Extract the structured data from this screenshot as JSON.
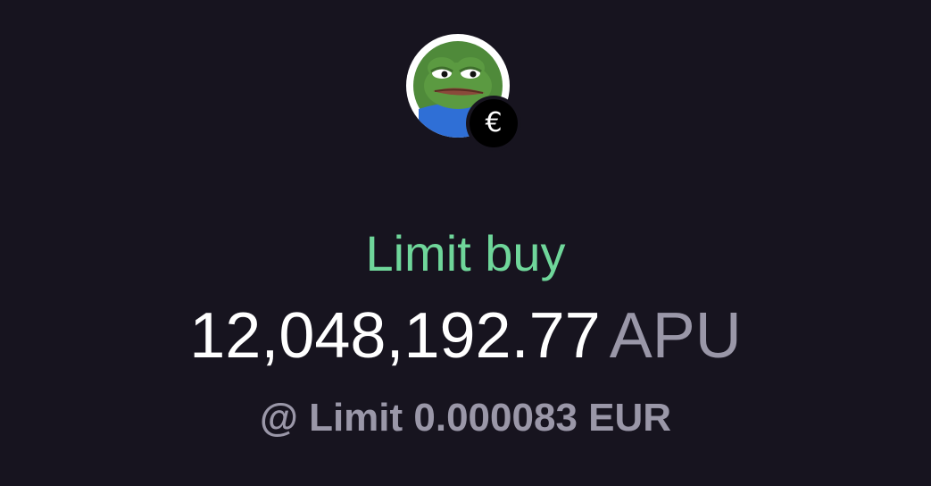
{
  "token": {
    "avatar_icon": "pepe-frog-token-icon",
    "currency_badge": {
      "icon": "euro-icon",
      "symbol": "€"
    }
  },
  "order": {
    "type_label": "Limit buy",
    "amount": "12,048,192.77",
    "unit": "APU",
    "limit_text": "@ Limit 0.000083 EUR"
  },
  "colors": {
    "background": "#17141f",
    "order_type": "#6fd69a",
    "amount": "#ffffff",
    "secondary": "#9a97a8",
    "avatar_ring": "#ffffff",
    "badge": "#000000"
  }
}
